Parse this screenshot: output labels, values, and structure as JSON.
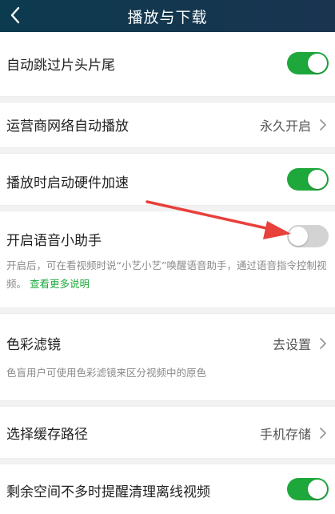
{
  "header": {
    "title": "播放与下载"
  },
  "settings": {
    "skip_intro": {
      "label": "自动跳过片头片尾",
      "enabled": true
    },
    "carrier_autoplay": {
      "label": "运营商网络自动播放",
      "value": "永久开启"
    },
    "hw_accel": {
      "label": "播放时启动硬件加速",
      "enabled": true
    },
    "voice_assistant": {
      "label": "开启语音小助手",
      "enabled": false,
      "description": "开启后，可在看视频时说“小艺小艺”唤醒语音助手，通过语音指令控制视频。",
      "link": "查看更多说明"
    },
    "color_filter": {
      "label": "色彩滤镜",
      "value": "去设置",
      "description": "色盲用户可使用色彩滤镜来区分视频中的原色"
    },
    "cache_path": {
      "label": "选择缓存路径",
      "value": "手机存储"
    },
    "low_space_reminder": {
      "label": "剩余空间不多时提醒清理离线视频",
      "enabled": true
    }
  },
  "colors": {
    "header_bg": "#0c3a4e",
    "toggle_on": "#1ea83b",
    "toggle_off": "#d3d3d3",
    "annotation_arrow": "#e8403a"
  }
}
